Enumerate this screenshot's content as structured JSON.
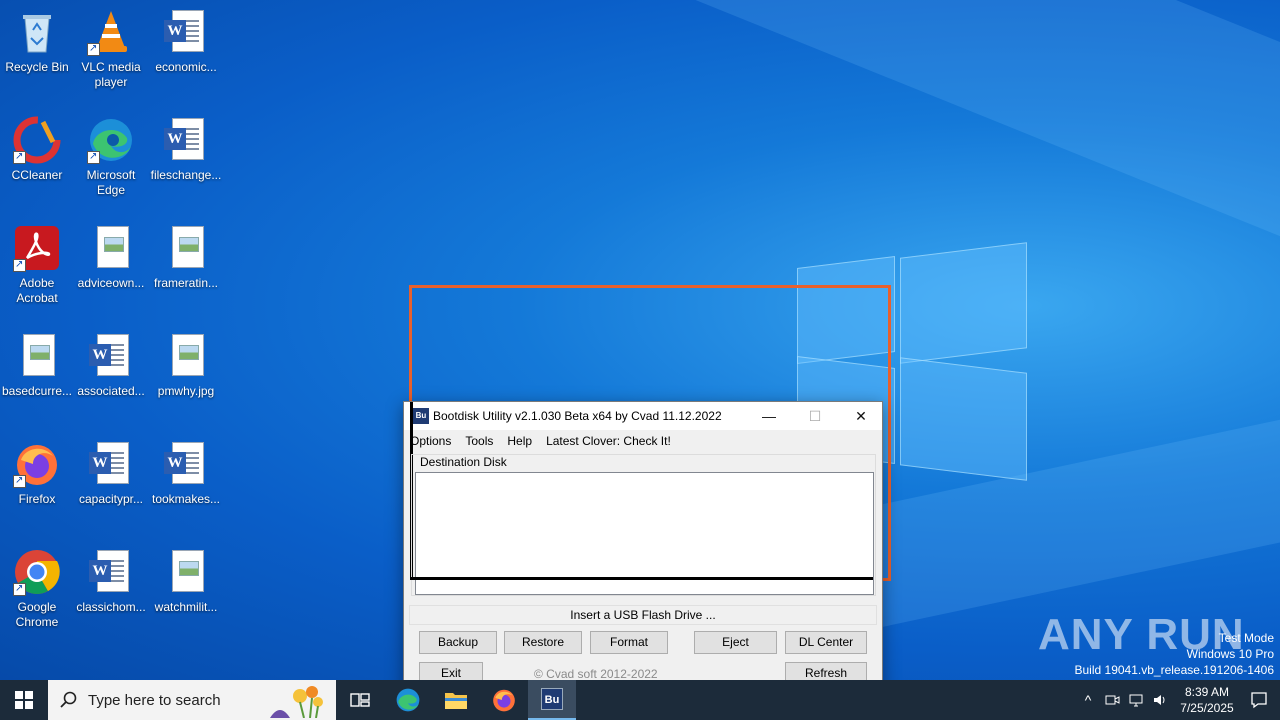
{
  "desktop_icons": [
    {
      "label": "Recycle Bin",
      "icon": "recycle-bin-icon"
    },
    {
      "label": "VLC media player",
      "icon": "vlc-icon"
    },
    {
      "label": "economic...",
      "icon": "word-doc-icon"
    },
    {
      "label": "CCleaner",
      "icon": "ccleaner-icon"
    },
    {
      "label": "Microsoft Edge",
      "icon": "edge-icon"
    },
    {
      "label": "fileschange...",
      "icon": "word-doc-icon"
    },
    {
      "label": "Adobe Acrobat",
      "icon": "acrobat-icon"
    },
    {
      "label": "adviceown...",
      "icon": "image-file-icon"
    },
    {
      "label": "frameratin...",
      "icon": "image-file-icon"
    },
    {
      "label": "basedcurre...",
      "icon": "image-file-icon"
    },
    {
      "label": "associated...",
      "icon": "word-doc-icon"
    },
    {
      "label": "pmwhy.jpg",
      "icon": "image-file-icon"
    },
    {
      "label": "Firefox",
      "icon": "firefox-icon"
    },
    {
      "label": "capacitypr...",
      "icon": "word-doc-icon"
    },
    {
      "label": "tookmakes...",
      "icon": "word-doc-icon"
    },
    {
      "label": "Google Chrome",
      "icon": "chrome-icon"
    },
    {
      "label": "classichom...",
      "icon": "word-doc-icon"
    },
    {
      "label": "watchmilit...",
      "icon": "image-file-icon"
    }
  ],
  "window": {
    "title": "Bootdisk Utility v2.1.030 Beta x64 by Cvad 11.12.2022",
    "icon_text": "Bu",
    "controls": {
      "minimize": "—",
      "maximize": "☐",
      "close": "✕"
    },
    "menu": [
      "Options",
      "Tools",
      "Help",
      "Latest Clover: Check It!"
    ],
    "destination_label": "Destination Disk",
    "status": "Insert a USB Flash Drive ...",
    "buttons": {
      "backup": "Backup",
      "restore": "Restore",
      "format": "Format",
      "eject": "Eject",
      "dl_center": "DL Center",
      "exit": "Exit",
      "refresh": "Refresh"
    },
    "copyright": "© Cvad soft 2012-2022"
  },
  "watermark": {
    "brand": "ANY RUN",
    "mode": "Test Mode",
    "os": "Windows 10 Pro",
    "build": "Build 19041.vb_release.191206-1406"
  },
  "taskbar": {
    "search_placeholder": "Type here to search",
    "pinned": [
      "task-view-icon",
      "edge-icon",
      "file-explorer-icon",
      "firefox-icon",
      "bootdisk-utility-icon"
    ],
    "clock_time": "8:39 AM",
    "clock_date": "7/25/2025"
  }
}
